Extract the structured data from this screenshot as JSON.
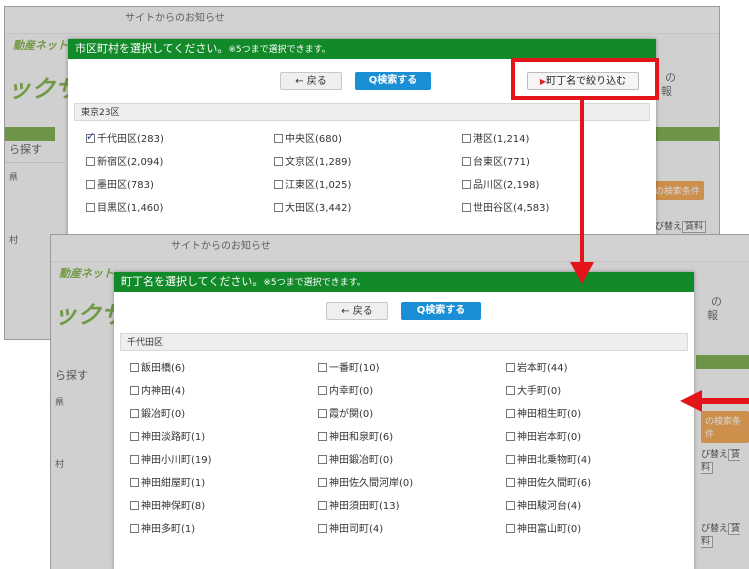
{
  "background": {
    "notice": "サイトからのお知らせ",
    "logo_top": "動産ネット",
    "logo_main": "ックサイ",
    "side_search": "ら探す",
    "side_pref": "県",
    "side_city": "村",
    "right_new": "の",
    "right_info": "報",
    "search_conditions": "の検索条件",
    "sort_label": "び替え",
    "sort_value": "賃料"
  },
  "modal1": {
    "title": "市区町村を選択してください。",
    "note": "※5つまで選択できます。",
    "back_label": "戻る",
    "search_label": "検索する",
    "filter_label": "町丁名で絞り込む",
    "section": "東京23区",
    "options": [
      {
        "label": "千代田区(283)",
        "checked": true
      },
      {
        "label": "中央区(680)",
        "checked": false
      },
      {
        "label": "港区(1,214)",
        "checked": false
      },
      {
        "label": "新宿区(2,094)",
        "checked": false
      },
      {
        "label": "文京区(1,289)",
        "checked": false
      },
      {
        "label": "台東区(771)",
        "checked": false
      },
      {
        "label": "墨田区(783)",
        "checked": false
      },
      {
        "label": "江東区(1,025)",
        "checked": false
      },
      {
        "label": "品川区(2,198)",
        "checked": false
      },
      {
        "label": "目黒区(1,460)",
        "checked": false
      },
      {
        "label": "大田区(3,442)",
        "checked": false
      },
      {
        "label": "世田谷区(4,583)",
        "checked": false
      }
    ]
  },
  "modal2": {
    "title": "町丁名を選択してください。",
    "note": "※5つまで選択できます。",
    "back_label": "戻る",
    "search_label": "検索する",
    "section": "千代田区",
    "options": [
      {
        "label": "飯田橋(6)",
        "checked": false
      },
      {
        "label": "一番町(10)",
        "checked": false
      },
      {
        "label": "岩本町(44)",
        "checked": false
      },
      {
        "label": "内神田(4)",
        "checked": false
      },
      {
        "label": "内幸町(0)",
        "checked": false
      },
      {
        "label": "大手町(0)",
        "checked": false
      },
      {
        "label": "鍛冶町(0)",
        "checked": false
      },
      {
        "label": "霞が関(0)",
        "checked": false
      },
      {
        "label": "神田相生町(0)",
        "checked": false
      },
      {
        "label": "神田淡路町(1)",
        "checked": false
      },
      {
        "label": "神田和泉町(6)",
        "checked": false
      },
      {
        "label": "神田岩本町(0)",
        "checked": false
      },
      {
        "label": "神田小川町(19)",
        "checked": false
      },
      {
        "label": "神田鍛冶町(0)",
        "checked": false
      },
      {
        "label": "神田北乗物町(4)",
        "checked": false
      },
      {
        "label": "神田紺屋町(1)",
        "checked": false
      },
      {
        "label": "神田佐久間河岸(0)",
        "checked": false
      },
      {
        "label": "神田佐久間町(6)",
        "checked": false
      },
      {
        "label": "神田神保町(8)",
        "checked": false
      },
      {
        "label": "神田須田町(13)",
        "checked": false
      },
      {
        "label": "神田駿河台(4)",
        "checked": false
      },
      {
        "label": "神田多町(1)",
        "checked": false
      },
      {
        "label": "神田司町(4)",
        "checked": false
      },
      {
        "label": "神田富山町(0)",
        "checked": false
      }
    ]
  },
  "colors": {
    "header_green": "#138a2a",
    "search_blue": "#1a8fd5",
    "annotation_red": "#e3141a"
  }
}
